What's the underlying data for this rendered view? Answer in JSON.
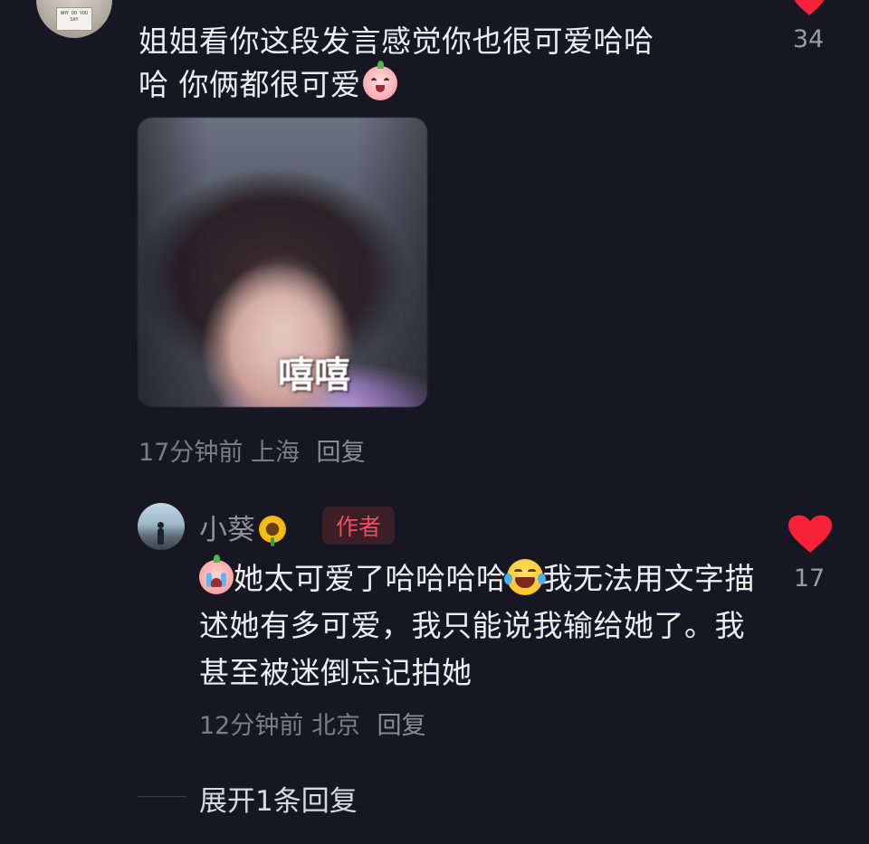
{
  "top_comment": {
    "text_line1": "姐姐看你这段发言感觉你也很可爱哈哈",
    "text_line2": "哈 你俩都很可爱",
    "emoji": "laughing-face-sticker-icon",
    "avatar_sign_text": "WHY DO YOU SAY",
    "image_caption": "嘻嘻",
    "time": "17分钟前",
    "location": "上海",
    "reply_label": "回复",
    "like_count": "34",
    "liked": true
  },
  "reply": {
    "author_name": "小葵",
    "name_emoji": "sunflower-icon",
    "author_badge": "作者",
    "text_part1": "她太可爱了哈哈哈哈",
    "text_part2": "我无法用文字描述她有多可爱，我只能说我输给她了。我甚至被迷倒忘记拍她",
    "time": "12分钟前",
    "location": "北京",
    "reply_label": "回复",
    "like_count": "17",
    "liked": true
  },
  "expand_replies": {
    "label": "展开1条回复"
  },
  "colors": {
    "background": "#161722",
    "like_red": "#f7213a",
    "author_badge_text": "#f14d5e",
    "muted_text": "#7c7d85"
  }
}
